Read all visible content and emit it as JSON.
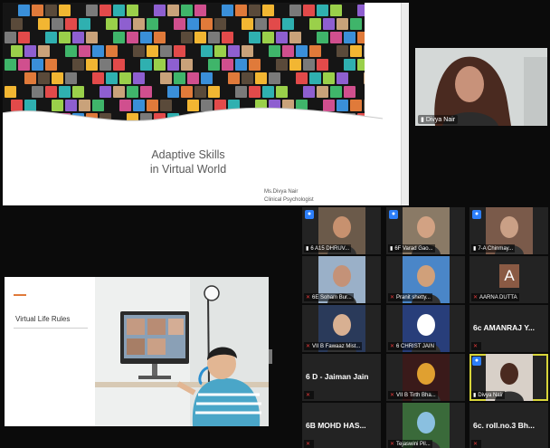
{
  "slide_top": {
    "title_line1": "Adaptive Skills",
    "title_line2": "in Virtual World",
    "author_name": "Ms.Divya Nair",
    "author_role": "Clinical Psychologist"
  },
  "speaker": {
    "name": "Divya Nair"
  },
  "slide_bottom": {
    "title": "Virtual Life Rules"
  },
  "participants": [
    {
      "label": "6 A15 DHRUV...",
      "type": "video",
      "muted": false
    },
    {
      "label": "6F Varad Gao...",
      "type": "video",
      "muted": false
    },
    {
      "label": "7-A Chinmay...",
      "type": "video",
      "muted": false
    },
    {
      "label": "6E Soham Bur...",
      "type": "video",
      "muted": true
    },
    {
      "label": "Pranit shetty...",
      "type": "video",
      "muted": true
    },
    {
      "label": "AARNA DUTTA",
      "type": "avatar",
      "avatar": "A",
      "muted": true
    },
    {
      "label": "VII B Fawaaz Mist...",
      "type": "video",
      "muted": true
    },
    {
      "label": "6 CHRIST JAIN",
      "type": "video",
      "muted": true
    },
    {
      "label": "6c AMANRAJ Y...",
      "type": "name",
      "muted": true
    },
    {
      "label": "6 D - Jaiman Jain",
      "type": "name",
      "muted": true
    },
    {
      "label": "VII B Tirth Bha...",
      "type": "video",
      "muted": true
    },
    {
      "label": "Divya Nair",
      "type": "video",
      "muted": false
    },
    {
      "label": "6B MOHD HAS...",
      "type": "name",
      "muted": true
    },
    {
      "label": "Tejaswini Pil...",
      "type": "video",
      "muted": true
    },
    {
      "label": "6c. roll.no.3 Bh...",
      "type": "name",
      "muted": true
    }
  ],
  "colors": {
    "active_speaker_outline": "#d8d53a",
    "mic_badge": "#2d7ff9",
    "muted_icon": "#e23a3a",
    "slide_accent": "#e07a3a"
  },
  "icons": {
    "mic": "microphone-icon",
    "mic_muted": "microphone-muted-icon",
    "signal": "signal-bars-icon"
  }
}
